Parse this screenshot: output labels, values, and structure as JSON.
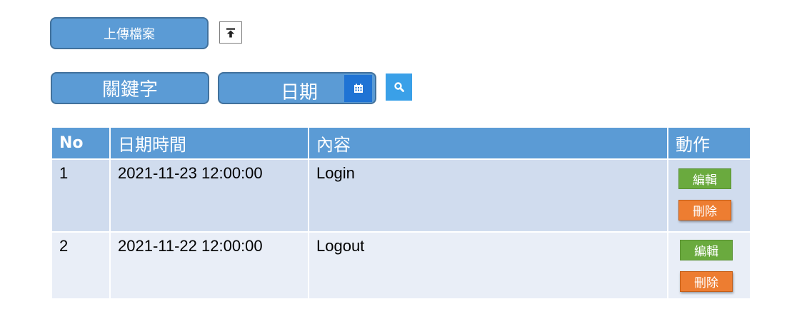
{
  "toolbar": {
    "upload_label": "上傳檔案",
    "upload_icon": "upload-icon"
  },
  "filters": {
    "keyword_label": "關鍵字",
    "date_label": "日期",
    "calendar_icon": "calendar-icon",
    "search_icon": "search-icon"
  },
  "table": {
    "headers": [
      "No",
      "日期時間",
      "內容",
      "動作"
    ],
    "rows": [
      {
        "no": "1",
        "datetime": "2021-11-23 12:00:00",
        "content": "Login",
        "edit": "編輯",
        "delete": "刪除"
      },
      {
        "no": "2",
        "datetime": "2021-11-22 12:00:00",
        "content": "Logout",
        "edit": "編輯",
        "delete": "刪除"
      }
    ]
  },
  "colors": {
    "primary": "#5b9bd5",
    "calendar": "#1f73d4",
    "search": "#3aa0e8",
    "edit": "#6aaa3e",
    "delete": "#ed7d31"
  }
}
